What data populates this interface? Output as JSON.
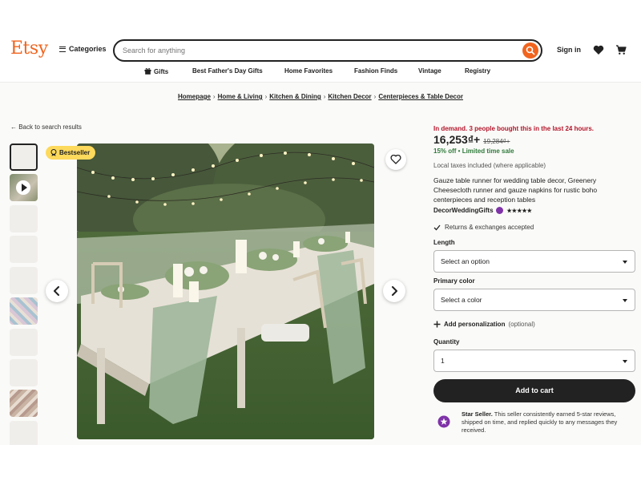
{
  "header": {
    "logo": "Etsy",
    "categories_label": "Categories",
    "search_placeholder": "Search for anything",
    "signin_label": "Sign in"
  },
  "subnav": {
    "items": [
      "Gifts",
      "Best Father's Day Gifts",
      "Home Favorites",
      "Fashion Finds",
      "Vintage",
      "Registry"
    ]
  },
  "breadcrumb": [
    "Homepage",
    "Home & Living",
    "Kitchen & Dining",
    "Kitchen Decor",
    "Centerpieces & Table Decor"
  ],
  "back_link": "← Back to search results",
  "badge": "Bestseller",
  "listing": {
    "demand_text": "In demand. 3 people bought this in the last 24 hours.",
    "price": "16,253₫+",
    "original_price": "19,284₫+",
    "discount_text": "15% off • Limited time sale",
    "taxes_text": "Local taxes included (where applicable)",
    "title": "Gauze table runner for wedding table decor, Greenery Cheesecloth runner and gauze napkins for rustic boho centerpieces and reception tables",
    "shop_name": "DecorWeddingGifts",
    "rating_stars": "★★★★★",
    "returns_text": "Returns & exchanges accepted"
  },
  "options": {
    "length_label": "Length",
    "length_value": "Select an option",
    "color_label": "Primary color",
    "color_value": "Select a color",
    "personalization_label": "Add personalization",
    "personalization_optional": "(optional)",
    "quantity_label": "Quantity",
    "quantity_value": "1",
    "add_to_cart": "Add to cart"
  },
  "star_seller": {
    "title": "Star Seller.",
    "text": "This seller consistently earned 5-star reviews, shipped on time, and replied quickly to any messages they received."
  },
  "colors": {
    "brand": "#f1641e",
    "demand": "#b3152a",
    "discount": "#2f7a3b",
    "bestseller": "#fdd95c",
    "star_seller": "#7f33a8"
  }
}
